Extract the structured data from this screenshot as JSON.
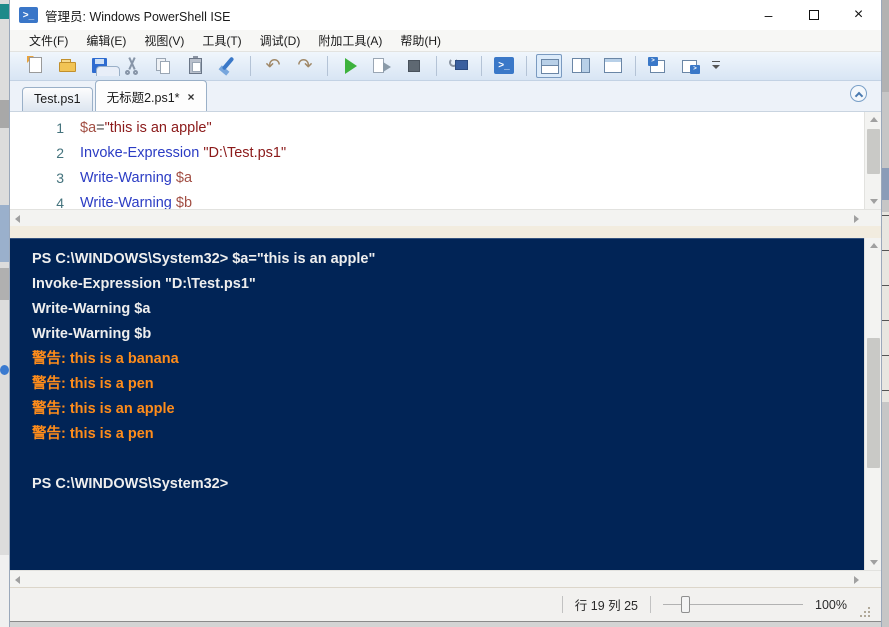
{
  "window": {
    "title": "管理员: Windows PowerShell ISE",
    "controls": {
      "minimize": "–",
      "maximize": "□",
      "close": "×"
    }
  },
  "menu": {
    "items": [
      "文件(F)",
      "编辑(E)",
      "视图(V)",
      "工具(T)",
      "调试(D)",
      "附加工具(A)",
      "帮助(H)"
    ]
  },
  "toolbar": {
    "groups": [
      [
        "new-script",
        "open-script",
        "save",
        "cut",
        "copy",
        "paste",
        "clear-console-pane"
      ],
      [
        "undo",
        "redo"
      ],
      [
        "run-script",
        "run-selection",
        "stop-operation"
      ],
      [
        "new-remote-powershell-tab"
      ],
      [
        "start-powershell"
      ],
      [
        "show-script-pane-top",
        "show-script-pane-right",
        "show-script-pane-maximized"
      ],
      [
        "new-powershell-tab",
        "close-powershell-tab"
      ]
    ],
    "selected": "show-script-pane-top",
    "overflow_icon": "toolbar-overflow"
  },
  "tabs": [
    {
      "label": "Test.ps1",
      "active": false,
      "closable": false
    },
    {
      "label": "无标题2.ps1*",
      "active": true,
      "closable": true,
      "close_glyph": "×"
    }
  ],
  "editor": {
    "lines": [
      {
        "number": "1",
        "tokens": [
          [
            "$a",
            "var"
          ],
          [
            "=",
            "op"
          ],
          [
            "\"this is an apple\"",
            "str"
          ]
        ]
      },
      {
        "number": "2",
        "tokens": [
          [
            "Invoke-Expression",
            "cmd"
          ],
          [
            " ",
            "pln"
          ],
          [
            "\"D:\\Test.ps1\"",
            "str"
          ]
        ]
      },
      {
        "number": "3",
        "tokens": [
          [
            "Write-Warning",
            "cmd"
          ],
          [
            " ",
            "pln"
          ],
          [
            "$a",
            "var"
          ]
        ]
      },
      {
        "number": "4",
        "tokens": [
          [
            "Write-Warning",
            "cmd"
          ],
          [
            " ",
            "pln"
          ],
          [
            "$b",
            "var"
          ]
        ]
      }
    ]
  },
  "console": {
    "lines": [
      {
        "text": "PS C:\\WINDOWS\\System32> $a=\"this is an apple\"",
        "type": "normal"
      },
      {
        "text": "Invoke-Expression \"D:\\Test.ps1\"",
        "type": "normal"
      },
      {
        "text": "Write-Warning $a",
        "type": "normal"
      },
      {
        "text": "Write-Warning $b",
        "type": "normal"
      },
      {
        "text": "警告: this is a banana",
        "type": "warning"
      },
      {
        "text": "警告: this is a pen",
        "type": "warning"
      },
      {
        "text": "警告: this is an apple",
        "type": "warning"
      },
      {
        "text": "警告: this is a pen",
        "type": "warning"
      },
      {
        "text": "",
        "type": "normal"
      },
      {
        "text": "PS C:\\WINDOWS\\System32>",
        "type": "normal"
      }
    ]
  },
  "statusbar": {
    "line_col": "行 19 列 25",
    "zoom": "100%"
  },
  "colors": {
    "console_background": "#012456",
    "console_text": "#eeeeee",
    "warning_text": "#ff8c1a",
    "cmdlet": "#2b3cc4",
    "string": "#8b1a1a",
    "variable": "#a24f44",
    "line_number": "#44737d",
    "toolbar_gradient_top": "#f0f6fc",
    "toolbar_gradient_bottom": "#d8e5f4"
  }
}
